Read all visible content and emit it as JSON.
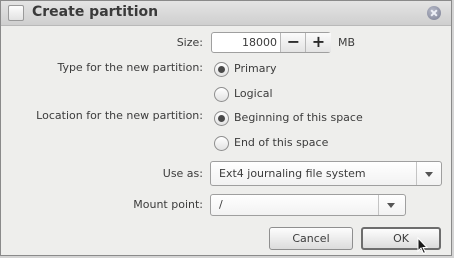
{
  "dialog": {
    "title": "Create partition",
    "size_label": "Size:",
    "size_value": "18000",
    "size_unit": "MB",
    "decrement_symbol": "−",
    "increment_symbol": "+",
    "type_label": "Type for the new partition:",
    "type_options": [
      {
        "label": "Primary",
        "selected": true
      },
      {
        "label": "Logical",
        "selected": false
      }
    ],
    "location_label": "Location for the new partition:",
    "location_options": [
      {
        "label": "Beginning of this space",
        "selected": true
      },
      {
        "label": "End of this space",
        "selected": false
      }
    ],
    "use_as_label": "Use as:",
    "use_as_value": "Ext4 journaling file system",
    "mount_point_label": "Mount point:",
    "mount_point_value": "/",
    "cancel_label": "Cancel",
    "ok_label": "OK"
  },
  "icons": [
    "window-checkbox-icon",
    "close-icon",
    "chevron-down-icon",
    "mouse-pointer-icon"
  ]
}
